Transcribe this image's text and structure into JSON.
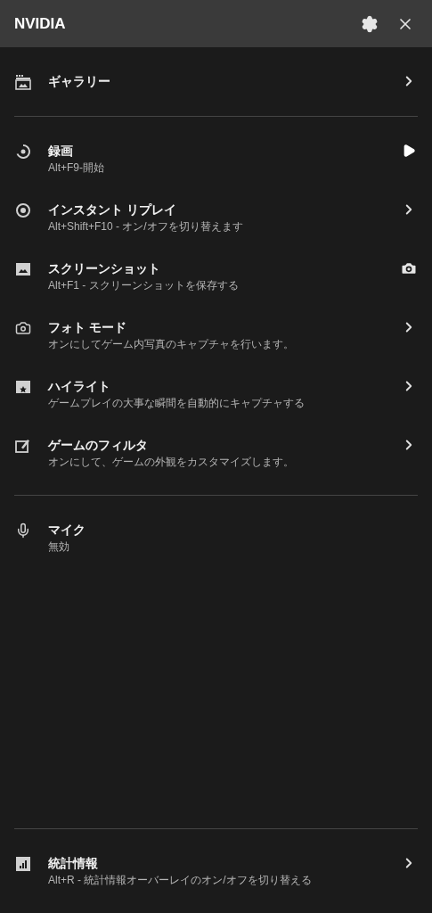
{
  "header": {
    "title": "NVIDIA"
  },
  "sections": [
    {
      "items": [
        {
          "title": "ギャラリー",
          "kind": "chevron"
        }
      ]
    },
    {
      "items": [
        {
          "title": "録画",
          "subtitle": "Alt+F9-開始",
          "kind": "play"
        },
        {
          "title": "インスタント リプレイ",
          "subtitle": "Alt+Shift+F10 - オン/オフを切り替えます",
          "kind": "chevron"
        },
        {
          "title": "スクリーンショット",
          "subtitle": "Alt+F1 - スクリーンショットを保存する",
          "kind": "camera"
        },
        {
          "title": "フォト モード",
          "subtitle": "オンにしてゲーム内写真のキャプチャを行います。",
          "kind": "chevron"
        },
        {
          "title": "ハイライト",
          "subtitle": "ゲームプレイの大事な瞬間を自動的にキャプチャする",
          "kind": "chevron"
        },
        {
          "title": "ゲームのフィルタ",
          "subtitle": "オンにして、ゲームの外観をカスタマイズします。",
          "kind": "chevron"
        }
      ]
    },
    {
      "items": [
        {
          "title": "マイク",
          "subtitle": "無効",
          "kind": "plain"
        }
      ]
    },
    {
      "items": [
        {
          "title": "統計情報",
          "subtitle": "Alt+R - 統計情報オーバーレイのオン/オフを切り替える",
          "kind": "chevron"
        }
      ]
    }
  ]
}
